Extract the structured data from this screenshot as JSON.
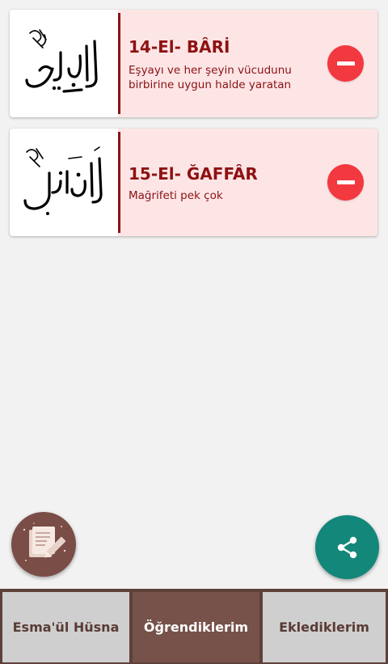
{
  "cards": [
    {
      "title": "14-El- BÂRİ",
      "description": "Eşyayı ve her şeyin vücudunu birbirine uygun halde yaratan",
      "calligraphy_icon": "calligraphy-el-bari"
    },
    {
      "title": "15-El- ĞAFFÂR",
      "description": "Mağrifeti pek çok",
      "calligraphy_icon": "calligraphy-el-gaffar"
    }
  ],
  "actions": {
    "left_fab_icon": "notes-edit-icon",
    "right_fab_icon": "share-icon"
  },
  "tabs": [
    {
      "label": "Esma'ül Hüsna"
    },
    {
      "label": "Öğrendiklerim"
    },
    {
      "label": "Eklediklerim"
    }
  ],
  "colors": {
    "accent": "#8f1212",
    "card_bg": "#fde5e6",
    "remove_button": "#f2393f",
    "share_fab": "#12877a",
    "notes_fab": "#7a4d46",
    "tab_active": "#76524b"
  }
}
